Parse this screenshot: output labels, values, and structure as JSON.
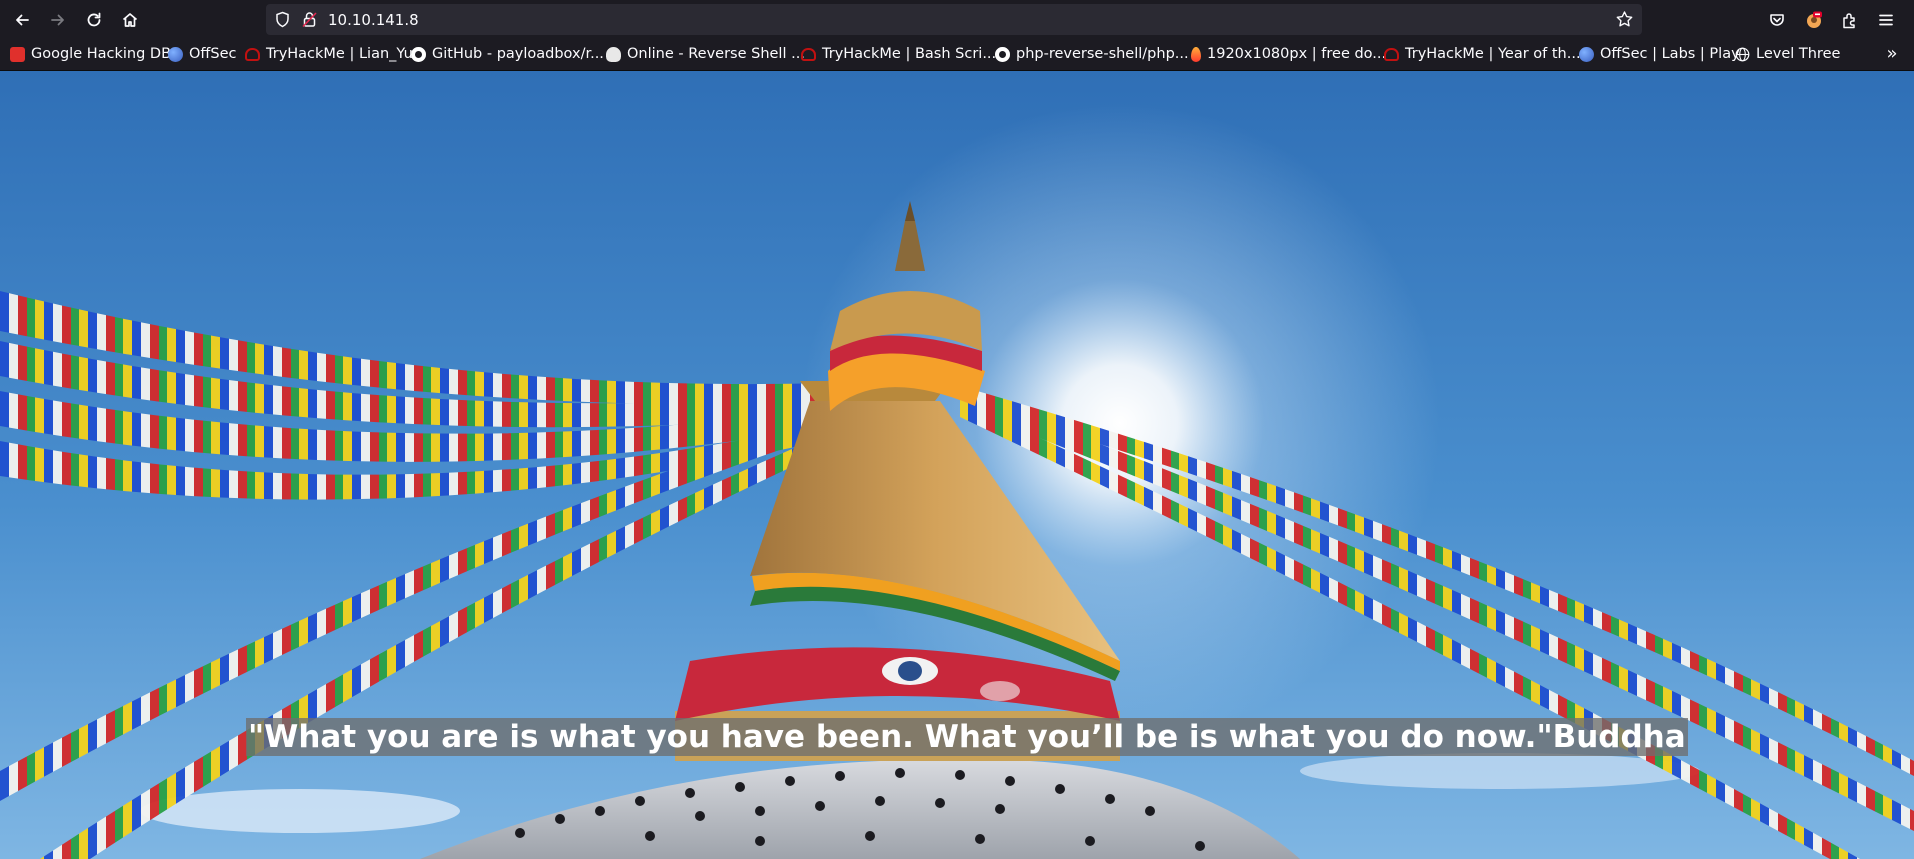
{
  "browser": {
    "url": "10.10.141.8",
    "nav_icons": [
      "back-arrow-icon",
      "forward-arrow-icon",
      "reload-icon",
      "home-icon"
    ],
    "urlbar_icons": [
      "shield-icon",
      "lock-icon",
      "star-icon"
    ],
    "toolbar_right_icons": [
      "pocket-icon",
      "profile-icon",
      "extensions-icon",
      "menu-icon"
    ]
  },
  "bookmarks": [
    {
      "label": "Google Hacking DB",
      "icon": "ghdb-icon",
      "color": "#e0302c"
    },
    {
      "label": "OffSec",
      "icon": "offsec-icon",
      "color": "#4a7fd4"
    },
    {
      "label": "TryHackMe | Lian_Yu",
      "icon": "tryhackme-icon",
      "color": "#c11111"
    },
    {
      "label": "GitHub - payloadbox/r...",
      "icon": "github-icon",
      "color": "#ffffff"
    },
    {
      "label": "Online - Reverse Shell ...",
      "icon": "skull-icon",
      "color": "#e8e8e8"
    },
    {
      "label": "TryHackMe | Bash Scri...",
      "icon": "tryhackme-icon",
      "color": "#c11111"
    },
    {
      "label": "php-reverse-shell/php...",
      "icon": "github-icon",
      "color": "#ffffff"
    },
    {
      "label": "1920x1080px | free do...",
      "icon": "fire-icon",
      "color": "#ff5a36"
    },
    {
      "label": "TryHackMe | Year of th...",
      "icon": "tryhackme-icon",
      "color": "#c11111"
    },
    {
      "label": "OffSec | Labs | Play",
      "icon": "offsec-icon",
      "color": "#4a7fd4"
    },
    {
      "label": "Level Three",
      "icon": "globe-icon",
      "color": "#fbfbfe"
    }
  ],
  "bookmarks_overflow_label": "»",
  "page": {
    "quote": "\"What you are is what you have been. What you’ll be is what you do now.\"Buddha"
  }
}
